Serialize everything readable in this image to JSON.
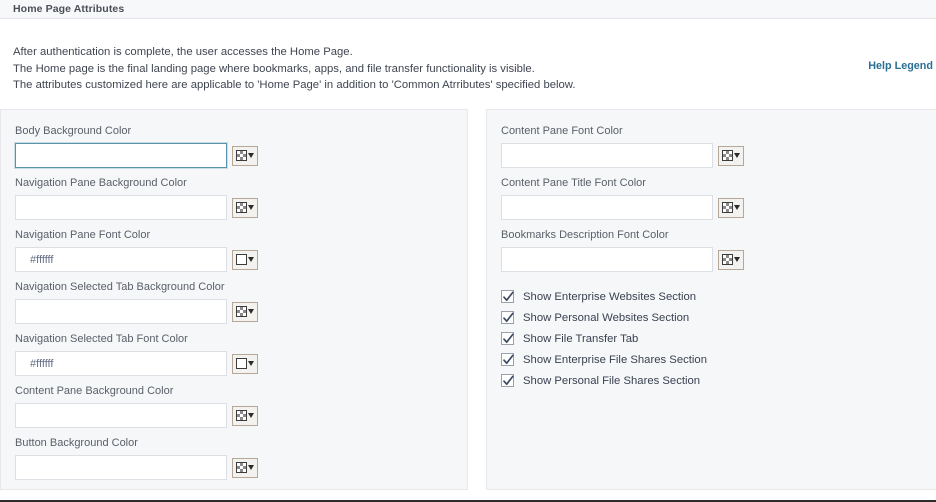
{
  "header": {
    "title": "Home Page Attributes"
  },
  "intro": {
    "lines": [
      "After authentication is complete, the user accesses the Home Page.",
      "The Home page is the final landing page where bookmarks, apps, and file transfer functionality is visible.",
      "The attributes customized here are applicable to 'Home Page' in addition to 'Common Atrributes' specified below."
    ],
    "help_legend_label": "Help Legend",
    "help_legend_color": "#2a7095"
  },
  "left_panel": {
    "fields": [
      {
        "label": "Body Background Color",
        "value": "",
        "placeholder": "",
        "focused": true,
        "swatch": "transparent-checker",
        "picker_icon": "color-picker-icon"
      },
      {
        "label": "Navigation Pane Background Color",
        "value": "",
        "placeholder": "",
        "focused": false,
        "swatch": "transparent-checker",
        "picker_icon": "color-picker-icon"
      },
      {
        "label": "Navigation Pane Font Color",
        "value": "#ffffff",
        "placeholder": "",
        "focused": false,
        "swatch": "white",
        "picker_icon": "color-picker-icon"
      },
      {
        "label": "Navigation Selected Tab Background Color",
        "value": "",
        "placeholder": "",
        "focused": false,
        "swatch": "transparent-checker",
        "picker_icon": "color-picker-icon"
      },
      {
        "label": "Navigation Selected Tab Font Color",
        "value": "#ffffff",
        "placeholder": "",
        "focused": false,
        "swatch": "white",
        "picker_icon": "color-picker-icon"
      },
      {
        "label": "Content Pane Background Color",
        "value": "",
        "placeholder": "",
        "focused": false,
        "swatch": "transparent-checker",
        "picker_icon": "color-picker-icon"
      },
      {
        "label": "Button Background Color",
        "value": "",
        "placeholder": "",
        "focused": false,
        "swatch": "transparent-checker",
        "picker_icon": "color-picker-icon"
      }
    ]
  },
  "right_panel": {
    "fields": [
      {
        "label": "Content Pane Font Color",
        "value": "",
        "placeholder": "",
        "focused": false,
        "swatch": "transparent-checker",
        "picker_icon": "color-picker-icon"
      },
      {
        "label": "Content Pane Title Font Color",
        "value": "",
        "placeholder": "",
        "focused": false,
        "swatch": "transparent-checker",
        "picker_icon": "color-picker-icon"
      },
      {
        "label": "Bookmarks Description Font Color",
        "value": "",
        "placeholder": "",
        "focused": false,
        "swatch": "transparent-checker",
        "picker_icon": "color-picker-icon"
      }
    ],
    "checkboxes": [
      {
        "label": "Show Enterprise Websites Section",
        "checked": true
      },
      {
        "label": "Show Personal Websites Section",
        "checked": true
      },
      {
        "label": "Show File Transfer Tab",
        "checked": true
      },
      {
        "label": "Show Enterprise File Shares Section",
        "checked": true
      },
      {
        "label": "Show Personal File Shares Section",
        "checked": true
      }
    ]
  }
}
